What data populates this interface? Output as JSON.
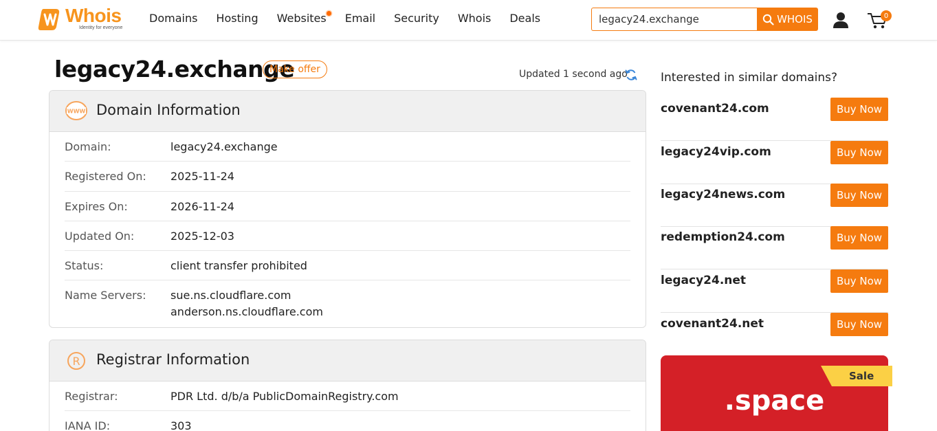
{
  "header": {
    "logo_text": "Whois",
    "logo_tagline": "Identity for everyone",
    "nav": [
      "Domains",
      "Hosting",
      "Websites",
      "Email",
      "Security",
      "Whois",
      "Deals"
    ],
    "search_value": "legacy24.exchange",
    "search_button": "WHOIS",
    "cart_count": "0",
    "accent_color": "#f57b0f"
  },
  "title": {
    "domain": "legacy24.exchange",
    "make_offer": "Make offer",
    "updated": "Updated 1 second ago"
  },
  "domain_info": {
    "heading": "Domain Information",
    "rows": [
      {
        "label": "Domain:",
        "value": "legacy24.exchange"
      },
      {
        "label": "Registered On:",
        "value": "2025-11-24"
      },
      {
        "label": "Expires On:",
        "value": "2026-11-24"
      },
      {
        "label": "Updated On:",
        "value": "2025-12-03"
      },
      {
        "label": "Status:",
        "value": "client transfer prohibited"
      },
      {
        "label": "Name Servers:",
        "value": "sue.ns.cloudflare.com",
        "value2": "anderson.ns.cloudflare.com"
      }
    ]
  },
  "registrar_info": {
    "heading": "Registrar Information",
    "rows": [
      {
        "label": "Registrar:",
        "value": "PDR Ltd. d/b/a PublicDomainRegistry.com"
      },
      {
        "label": "IANA ID:",
        "value": "303"
      }
    ]
  },
  "sidebar": {
    "title": "Interested in similar domains?",
    "suggestions": [
      {
        "name": "covenant24.com",
        "button": "Buy Now"
      },
      {
        "name": "legacy24vip.com",
        "button": "Buy Now"
      },
      {
        "name": "legacy24news.com",
        "button": "Buy Now"
      },
      {
        "name": "redemption24.com",
        "button": "Buy Now"
      },
      {
        "name": "legacy24.net",
        "button": "Buy Now"
      },
      {
        "name": "covenant24.net",
        "button": "Buy Now"
      }
    ],
    "promo": {
      "tld": ".space",
      "tag": "Sale"
    }
  }
}
